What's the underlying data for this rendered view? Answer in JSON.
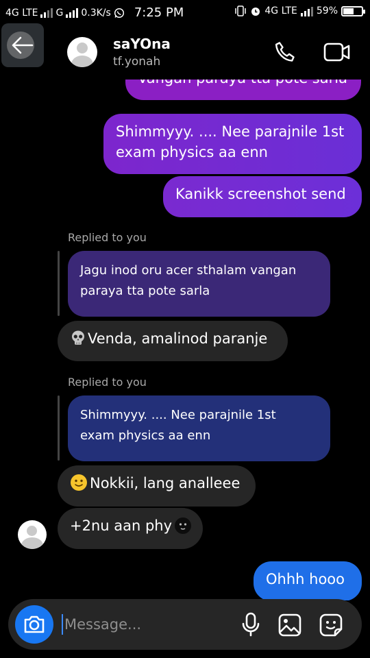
{
  "status_bar": {
    "network_left": "4G LTE",
    "network_mid": "G",
    "speed": "0.3K/s",
    "time": "7:25 PM",
    "network_right": "4G LTE",
    "battery_percent": "59%",
    "battery_level": 0.59
  },
  "header": {
    "contact_name": "saYOna",
    "contact_handle": "tf.yonah"
  },
  "messages": {
    "sent_cut": "Vangan paraya tta pote sarla",
    "sent_1": {
      "line1": "Shimmyyy. .... Nee parajnile 1st",
      "line2": "exam physics aa enn"
    },
    "sent_2": "Kanikk screenshot send",
    "reply_1": {
      "label": "Replied to you",
      "quote_line1": "Jagu inod oru acer sthalam vangan",
      "quote_line2": "paraya tta pote sarla",
      "text": "Venda, amalinod paranje"
    },
    "reply_2": {
      "label": "Replied to you",
      "quote_line1": "Shimmyyy. .... Nee parajnile 1st",
      "quote_line2": "exam physics aa enn",
      "text": "Nokkii, lang analleee"
    },
    "received_3": "+2nu aan phy",
    "sent_3": "Ohhh hooo"
  },
  "composer": {
    "placeholder": "Message..."
  },
  "colors": {
    "sent_purple": "#8b1fc4",
    "sent_violet": "#6a2fd6",
    "sent_blue": "#1f6fe8",
    "quote_purple": "#3b2877",
    "quote_navy": "#233079",
    "received_gray": "#262626",
    "camera_blue": "#1877f2"
  }
}
